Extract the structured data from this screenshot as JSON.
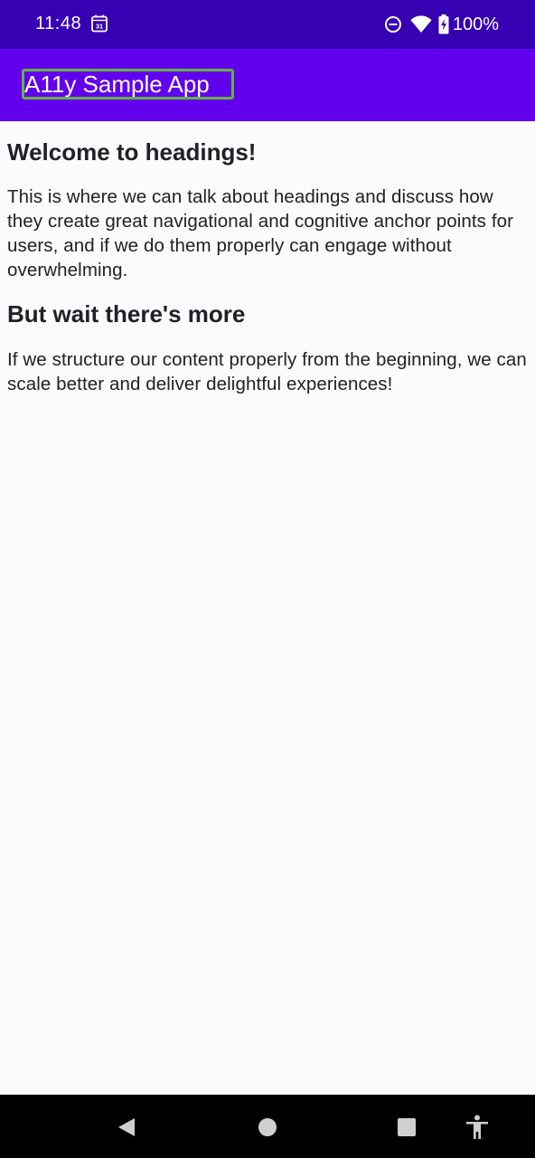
{
  "status_bar": {
    "time": "11:48",
    "calendar_icon": "calendar-icon",
    "calendar_day": "31",
    "battery_percent": "100%",
    "colors": {
      "background": "#3700b3",
      "foreground": "#ffffff"
    }
  },
  "app_bar": {
    "title": "A11y Sample App",
    "colors": {
      "background": "#6200ee",
      "focus_outline": "#63b342"
    }
  },
  "content": {
    "heading_1": "Welcome to headings!",
    "paragraph_1": "This is where we can talk about headings and discuss how they create great navigational and cognitive anchor points for users, and if we do them properly can engage without overwhelming.",
    "heading_2": "But wait there's more",
    "paragraph_2": "If we structure our content properly from the beginning, we can scale better and deliver delightful experiences!"
  },
  "nav_bar": {
    "buttons": [
      "back-icon",
      "home-icon",
      "recents-icon",
      "accessibility-icon"
    ]
  }
}
